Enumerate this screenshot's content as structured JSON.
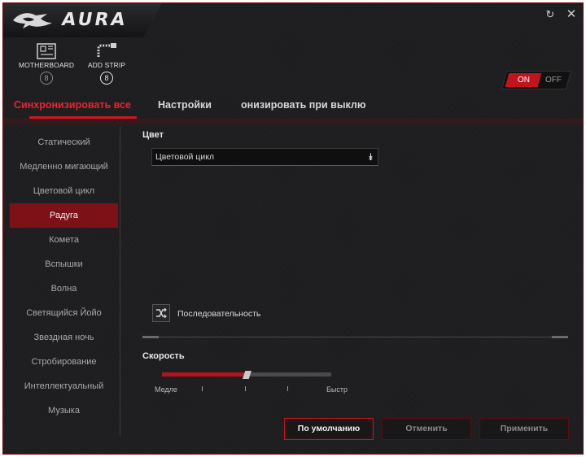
{
  "app": {
    "name": "AURA"
  },
  "devices": [
    {
      "label": "MOTHERBOARD",
      "badge": "8"
    },
    {
      "label": "ADD STRIP",
      "badge": "8"
    }
  ],
  "power_toggle": {
    "on_label": "ON",
    "off_label": "OFF",
    "state": "on"
  },
  "tabs": [
    {
      "label": "Синхронизировать все",
      "active": true
    },
    {
      "label": "Настройки",
      "active": false
    },
    {
      "label": "онизировать при выклю",
      "active": false
    }
  ],
  "effects": [
    {
      "label": "Статический"
    },
    {
      "label": "Медленно мигающий"
    },
    {
      "label": "Цветовой цикл"
    },
    {
      "label": "Радуга",
      "active": true
    },
    {
      "label": "Комета"
    },
    {
      "label": "Вспышки"
    },
    {
      "label": "Волна"
    },
    {
      "label": "Светящийся Йойо"
    },
    {
      "label": "Звездная ночь"
    },
    {
      "label": "Стробирование"
    },
    {
      "label": "Интеллектуальный"
    },
    {
      "label": "Музыка"
    }
  ],
  "color": {
    "label": "Цвет",
    "selected": "Цветовой цикл"
  },
  "sequence": {
    "label": "Последовательность"
  },
  "speed": {
    "label": "Скорость",
    "min_label": "Медле",
    "max_label": "Быстр",
    "value_fraction": 0.5
  },
  "buttons": {
    "default_label": "По умолчанию",
    "cancel_label": "Отменить",
    "apply_label": "Применить"
  },
  "colors": {
    "accent": "#c0141e",
    "active_effect_bg": "#7e1118",
    "background": "#1c1c1e"
  }
}
